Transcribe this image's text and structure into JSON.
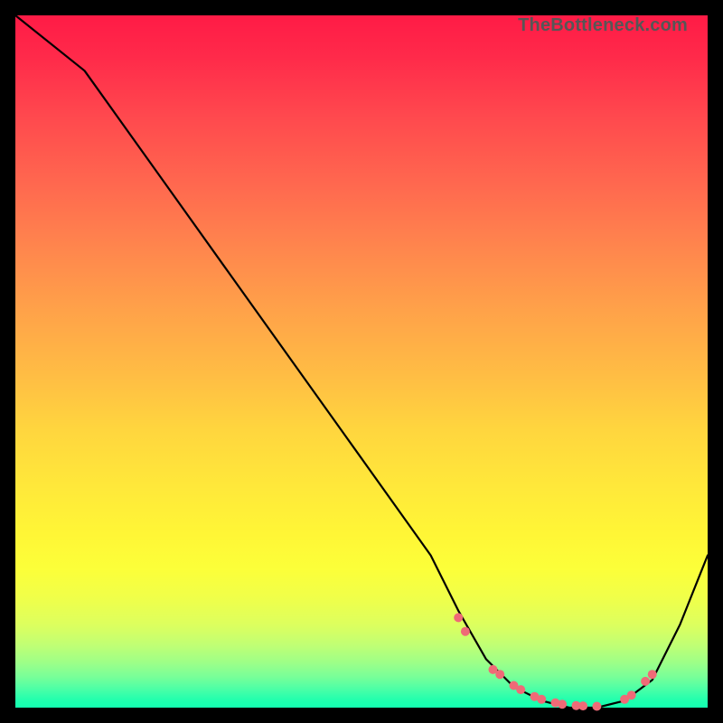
{
  "watermark": "TheBottleneck.com",
  "chart_data": {
    "type": "line",
    "title": "",
    "xlabel": "",
    "ylabel": "",
    "xlim": [
      0,
      100
    ],
    "ylim": [
      0,
      100
    ],
    "series": [
      {
        "name": "curve",
        "x": [
          0,
          10,
          20,
          30,
          40,
          50,
          60,
          64,
          68,
          72,
          76,
          80,
          84,
          88,
          92,
          96,
          100
        ],
        "y": [
          100,
          92,
          78,
          64,
          50,
          36,
          22,
          14,
          7,
          3,
          1,
          0,
          0,
          1,
          4,
          12,
          22
        ]
      }
    ],
    "markers": {
      "name": "highlight-points",
      "color": "#ef6a77",
      "x": [
        64,
        65,
        69,
        70,
        72,
        73,
        75,
        76,
        78,
        79,
        81,
        82,
        84,
        88,
        89,
        91,
        92
      ],
      "y": [
        13,
        11,
        5.5,
        4.8,
        3.2,
        2.6,
        1.6,
        1.2,
        0.7,
        0.5,
        0.3,
        0.25,
        0.2,
        1.2,
        1.8,
        3.8,
        4.8
      ]
    }
  }
}
